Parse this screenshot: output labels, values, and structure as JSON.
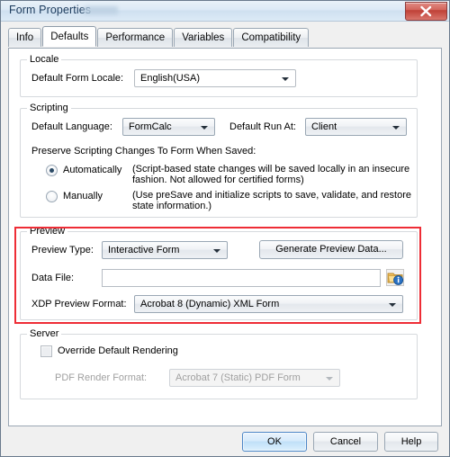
{
  "window": {
    "title": "Form Properties",
    "close_icon": "close-x-icon"
  },
  "tabs": [
    {
      "label": "Info",
      "active": false
    },
    {
      "label": "Defaults",
      "active": true
    },
    {
      "label": "Performance",
      "active": false
    },
    {
      "label": "Variables",
      "active": false
    },
    {
      "label": "Compatibility",
      "active": false
    }
  ],
  "locale": {
    "group_title": "Locale",
    "field_label": "Default Form Locale:",
    "value": "English(USA)"
  },
  "scripting": {
    "group_title": "Scripting",
    "language_label": "Default Language:",
    "language_value": "FormCalc",
    "run_at_label": "Default Run At:",
    "run_at_value": "Client",
    "preserve_label": "Preserve Scripting Changes To Form When Saved:",
    "options": [
      {
        "label": "Automatically",
        "selected": true,
        "description_line1": "(Script-based state changes will be saved locally in an insecure",
        "description_line2": "fashion.  Not allowed for certified forms)"
      },
      {
        "label": "Manually",
        "selected": false,
        "description_line1": "(Use preSave and initialize scripts to save, validate, and restore",
        "description_line2": "state information.)"
      }
    ]
  },
  "preview": {
    "group_title": "Preview",
    "highlighted": true,
    "highlight_color": "#ee2d36",
    "type_label": "Preview Type:",
    "type_value": "Interactive Form",
    "generate_button": "Generate Preview Data...",
    "data_file_label": "Data File:",
    "data_file_value": "",
    "data_file_placeholder": "",
    "browse_icon": "folder-browse-icon",
    "xdp_label": "XDP Preview Format:",
    "xdp_value": "Acrobat 8 (Dynamic) XML Form"
  },
  "server": {
    "group_title": "Server",
    "override_label": "Override Default Rendering",
    "override_checked": false,
    "render_format_label": "PDF Render Format:",
    "render_format_value": "Acrobat 7 (Static) PDF Form",
    "render_format_disabled": true
  },
  "footer": {
    "ok": "OK",
    "cancel": "Cancel",
    "help": "Help"
  }
}
